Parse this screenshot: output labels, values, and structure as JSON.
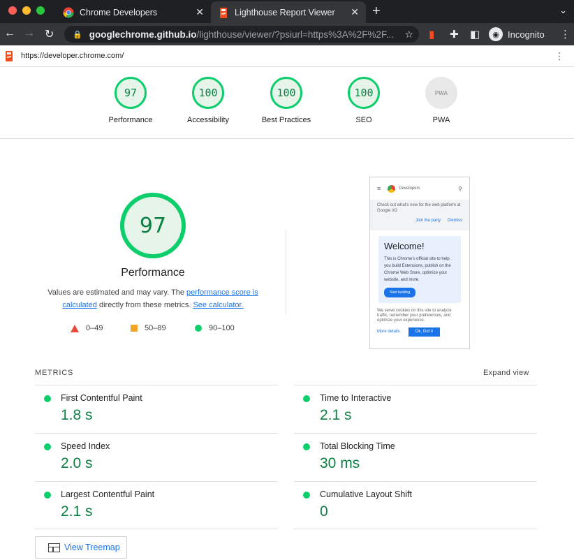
{
  "browser": {
    "tabs": [
      {
        "title": "Chrome Developers",
        "active": false
      },
      {
        "title": "Lighthouse Report Viewer",
        "active": true
      }
    ],
    "new_tab": "+",
    "omnibox": {
      "host": "googlechrome.github.io",
      "path": "/lighthouse/viewer/?psiurl=https%3A%2F%2F..."
    },
    "profile_label": "Incognito"
  },
  "report": {
    "url": "https://developer.chrome.com/",
    "categories": [
      {
        "score": "97",
        "label": "Performance"
      },
      {
        "score": "100",
        "label": "Accessibility"
      },
      {
        "score": "100",
        "label": "Best Practices"
      },
      {
        "score": "100",
        "label": "SEO"
      },
      {
        "score": "PWA",
        "label": "PWA"
      }
    ],
    "performance": {
      "score": "97",
      "title": "Performance",
      "desc_prefix": "Values are estimated and may vary. The ",
      "desc_link1": "performance score is calculated",
      "desc_mid": " directly from these metrics. ",
      "desc_link2": "See calculator."
    },
    "legend": [
      {
        "range": "0–49",
        "color": "#e8483a"
      },
      {
        "range": "50–89",
        "color": "#f4a527"
      },
      {
        "range": "90–100",
        "color": "#0cce6b"
      }
    ],
    "metrics_label": "METRICS",
    "expand_label": "Expand view",
    "metrics": [
      {
        "name": "First Contentful Paint",
        "value": "1.8 s"
      },
      {
        "name": "Time to Interactive",
        "value": "2.1 s"
      },
      {
        "name": "Speed Index",
        "value": "2.0 s"
      },
      {
        "name": "Total Blocking Time",
        "value": "30 ms"
      },
      {
        "name": "Largest Contentful Paint",
        "value": "2.1 s"
      },
      {
        "name": "Cumulative Layout Shift",
        "value": "0"
      }
    ],
    "treemap_label": "View Treemap",
    "screenshot": {
      "site_name": "Developers",
      "promo_text": "Check out what's new for the web platform at Google I/O",
      "promo_link1": "Join the party",
      "promo_link2": "Dismiss",
      "welcome_title": "Welcome!",
      "welcome_text": "This is Chrome's official site to help you build Extensions, publish on the Chrome Web Store, optimize your website, and more.",
      "welcome_button": "Start building",
      "cookie_text": "We serve cookies on this site to analyze traffic, remember your preferences, and optimize your experience.",
      "cookie_link": "More details",
      "cookie_button": "Ok, Got it"
    }
  }
}
